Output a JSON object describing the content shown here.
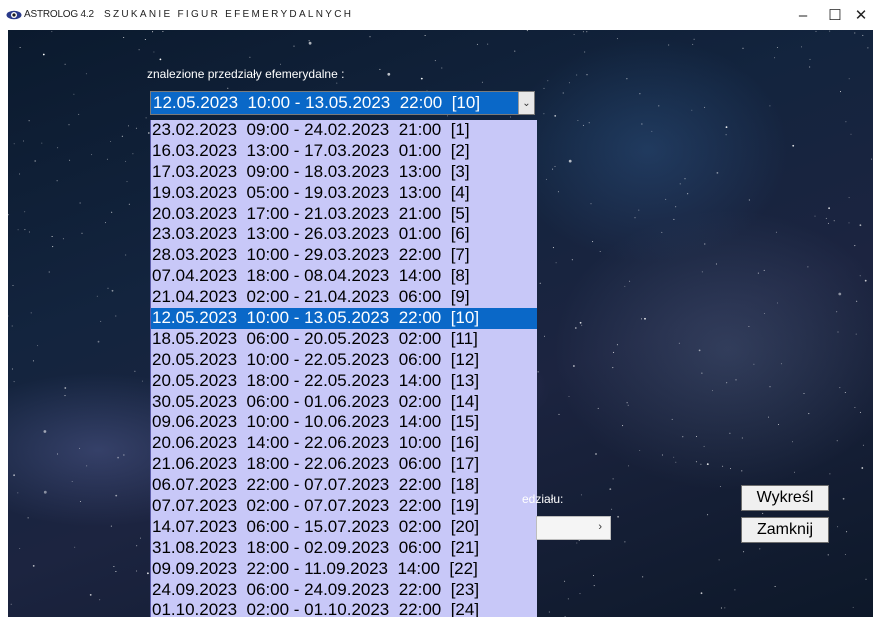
{
  "titlebar": {
    "app_name": "ASTROLOG 4.2",
    "window_title": "SZUKANIE FIGUR EFEMERYDALNYCH",
    "minimize": "–",
    "maximize": "☐",
    "close": "✕"
  },
  "main": {
    "found_label": "znalezione przedziały efemerydalne :",
    "combo_value": "12.05.2023  10:00 - 13.05.2023  22:00  [10]",
    "combo_arrow": "⌄",
    "selected_index": 9,
    "dropdown_items": [
      "23.02.2023  09:00 - 24.02.2023  21:00  [1]",
      "16.03.2023  13:00 - 17.03.2023  01:00  [2]",
      "17.03.2023  09:00 - 18.03.2023  13:00  [3]",
      "19.03.2023  05:00 - 19.03.2023  13:00  [4]",
      "20.03.2023  17:00 - 21.03.2023  21:00  [5]",
      "23.03.2023  13:00 - 26.03.2023  01:00  [6]",
      "28.03.2023  10:00 - 29.03.2023  22:00  [7]",
      "07.04.2023  18:00 - 08.04.2023  14:00  [8]",
      "21.04.2023  02:00 - 21.04.2023  06:00  [9]",
      "12.05.2023  10:00 - 13.05.2023  22:00  [10]",
      "18.05.2023  06:00 - 20.05.2023  02:00  [11]",
      "20.05.2023  10:00 - 22.05.2023  06:00  [12]",
      "20.05.2023  18:00 - 22.05.2023  14:00  [13]",
      "30.05.2023  06:00 - 01.06.2023  02:00  [14]",
      "09.06.2023  10:00 - 10.06.2023  14:00  [15]",
      "20.06.2023  14:00 - 22.06.2023  10:00  [16]",
      "21.06.2023  18:00 - 22.06.2023  06:00  [17]",
      "06.07.2023  22:00 - 07.07.2023  22:00  [18]",
      "07.07.2023  02:00 - 07.07.2023  22:00  [19]",
      "14.07.2023  06:00 - 15.07.2023  02:00  [20]",
      "31.08.2023  18:00 - 02.09.2023  06:00  [21]",
      "09.09.2023  22:00 - 11.09.2023  14:00  [22]",
      "24.09.2023  06:00 - 24.09.2023  22:00  [23]",
      "01.10.2023  02:00 - 01.10.2023  22:00  [24]"
    ],
    "partial_label": "edziału:",
    "select2_arrow": "›"
  },
  "buttons": {
    "draw": "Wykreśl",
    "close": "Zamknij"
  },
  "colors": {
    "selection": "#0a68c8",
    "dropdown_bg": "#c8c8f8"
  }
}
